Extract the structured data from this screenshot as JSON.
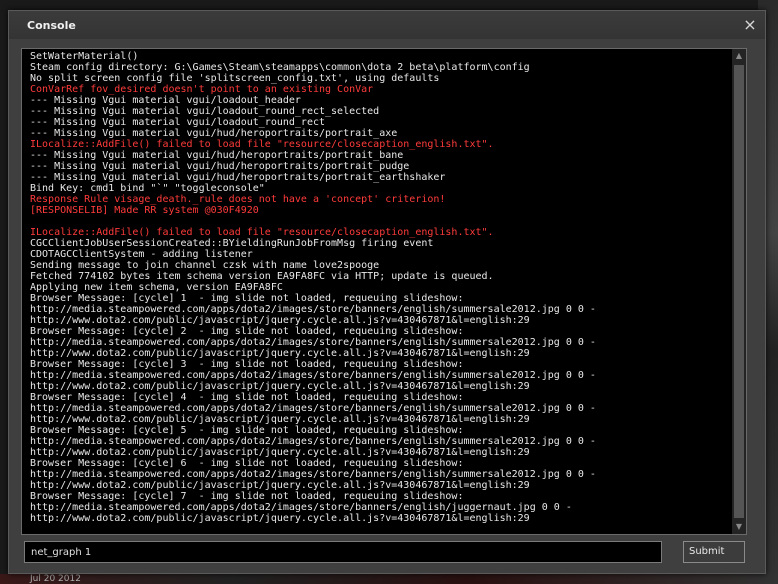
{
  "window": {
    "title": "Console",
    "close_glyph": "×",
    "close_icon": "close-icon"
  },
  "console_lines": [
    {
      "text": "SetWaterMaterial()",
      "error": false
    },
    {
      "text": "Steam config directory: G:\\Games\\Steam\\steamapps\\common\\dota 2 beta\\platform\\config",
      "error": false
    },
    {
      "text": "No split screen config file 'splitscreen_config.txt', using defaults",
      "error": false
    },
    {
      "text": "ConVarRef fov_desired doesn't point to an existing ConVar",
      "error": true
    },
    {
      "text": "--- Missing Vgui material vgui/loadout_header",
      "error": false
    },
    {
      "text": "--- Missing Vgui material vgui/loadout_round_rect_selected",
      "error": false
    },
    {
      "text": "--- Missing Vgui material vgui/loadout_round_rect",
      "error": false
    },
    {
      "text": "--- Missing Vgui material vgui/hud/heroportraits/portrait_axe",
      "error": false
    },
    {
      "text": "ILocalize::AddFile() failed to load file \"resource/closecaption_english.txt\".",
      "error": true
    },
    {
      "text": "--- Missing Vgui material vgui/hud/heroportraits/portrait_bane",
      "error": false
    },
    {
      "text": "--- Missing Vgui material vgui/hud/heroportraits/portrait_pudge",
      "error": false
    },
    {
      "text": "--- Missing Vgui material vgui/hud/heroportraits/portrait_earthshaker",
      "error": false
    },
    {
      "text": "Bind Key: cmd1 bind \"`\" \"toggleconsole\"",
      "error": false
    },
    {
      "text": "Response Rule visage_death._rule does not have a 'concept' criterion!",
      "error": true
    },
    {
      "text": "[RESPONSELIB] Made RR system @030F4920",
      "error": true
    },
    {
      "text": "",
      "error": false
    },
    {
      "text": "ILocalize::AddFile() failed to load file \"resource/closecaption_english.txt\".",
      "error": true
    },
    {
      "text": "CGCClientJobUserSessionCreated::BYieldingRunJobFromMsg firing event",
      "error": false
    },
    {
      "text": "CDOTAGCClientSystem - adding listener",
      "error": false
    },
    {
      "text": "Sending message to join channel czsk with name love2spooge",
      "error": false
    },
    {
      "text": "Fetched 774102 bytes item schema version EA9FA8FC via HTTP; update is queued.",
      "error": false
    },
    {
      "text": "Applying new item schema, version EA9FA8FC",
      "error": false
    },
    {
      "text": "Browser Message: [cycle] 1  - img slide not loaded, requeuing slideshow:",
      "error": false
    },
    {
      "text": "http://media.steampowered.com/apps/dota2/images/store/banners/english/summersale2012.jpg 0 0 -",
      "error": false
    },
    {
      "text": "http://www.dota2.com/public/javascript/jquery.cycle.all.js?v=430467871&l=english:29",
      "error": false
    },
    {
      "text": "Browser Message: [cycle] 2  - img slide not loaded, requeuing slideshow:",
      "error": false
    },
    {
      "text": "http://media.steampowered.com/apps/dota2/images/store/banners/english/summersale2012.jpg 0 0 -",
      "error": false
    },
    {
      "text": "http://www.dota2.com/public/javascript/jquery.cycle.all.js?v=430467871&l=english:29",
      "error": false
    },
    {
      "text": "Browser Message: [cycle] 3  - img slide not loaded, requeuing slideshow:",
      "error": false
    },
    {
      "text": "http://media.steampowered.com/apps/dota2/images/store/banners/english/summersale2012.jpg 0 0 -",
      "error": false
    },
    {
      "text": "http://www.dota2.com/public/javascript/jquery.cycle.all.js?v=430467871&l=english:29",
      "error": false
    },
    {
      "text": "Browser Message: [cycle] 4  - img slide not loaded, requeuing slideshow:",
      "error": false
    },
    {
      "text": "http://media.steampowered.com/apps/dota2/images/store/banners/english/summersale2012.jpg 0 0 -",
      "error": false
    },
    {
      "text": "http://www.dota2.com/public/javascript/jquery.cycle.all.js?v=430467871&l=english:29",
      "error": false
    },
    {
      "text": "Browser Message: [cycle] 5  - img slide not loaded, requeuing slideshow:",
      "error": false
    },
    {
      "text": "http://media.steampowered.com/apps/dota2/images/store/banners/english/summersale2012.jpg 0 0 -",
      "error": false
    },
    {
      "text": "http://www.dota2.com/public/javascript/jquery.cycle.all.js?v=430467871&l=english:29",
      "error": false
    },
    {
      "text": "Browser Message: [cycle] 6  - img slide not loaded, requeuing slideshow:",
      "error": false
    },
    {
      "text": "http://media.steampowered.com/apps/dota2/images/store/banners/english/summersale2012.jpg 0 0 -",
      "error": false
    },
    {
      "text": "http://www.dota2.com/public/javascript/jquery.cycle.all.js?v=430467871&l=english:29",
      "error": false
    },
    {
      "text": "Browser Message: [cycle] 7  - img slide not loaded, requeuing slideshow:",
      "error": false
    },
    {
      "text": "http://media.steampowered.com/apps/dota2/images/store/banners/english/juggernaut.jpg 0 0 -",
      "error": false
    },
    {
      "text": "http://www.dota2.com/public/javascript/jquery.cycle.all.js?v=430467871&l=english:29",
      "error": false
    }
  ],
  "input": {
    "value": "net_graph 1"
  },
  "submit": {
    "label": "Submit"
  },
  "background": {
    "date_text": "Jul 20 2012"
  },
  "colors": {
    "error_text": "#ff3b3b",
    "normal_text": "#e8e8e8",
    "window_bg": "#3f3f3f",
    "output_bg": "#000000"
  },
  "scrollbar": {
    "up_icon": "arrow-up-icon",
    "down_icon": "arrow-down-icon"
  }
}
